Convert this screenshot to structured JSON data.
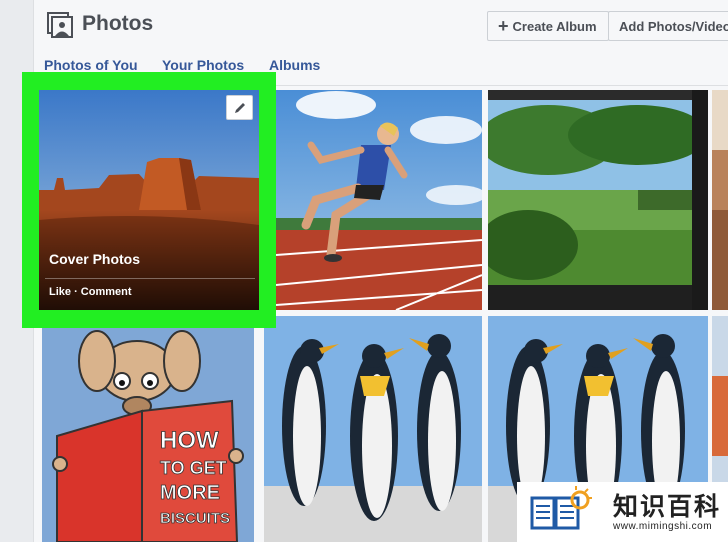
{
  "header": {
    "title": "Photos",
    "create_album_label": "Create Album",
    "add_photos_label": "Add Photos/Video"
  },
  "tabs": [
    {
      "label": "Photos of You"
    },
    {
      "label": "Your Photos"
    },
    {
      "label": "Albums"
    }
  ],
  "albums": {
    "cover": {
      "label": "Cover Photos",
      "actions": "Like · Comment"
    },
    "book_text": [
      "HOW",
      "TO GET",
      "MORE",
      "BISCUITS"
    ]
  },
  "watermark": {
    "title": "知识百科",
    "url": "www.mimingshi.com"
  },
  "colors": {
    "highlight": "#22ee22",
    "link": "#365899",
    "header_text": "#4b4f56"
  }
}
